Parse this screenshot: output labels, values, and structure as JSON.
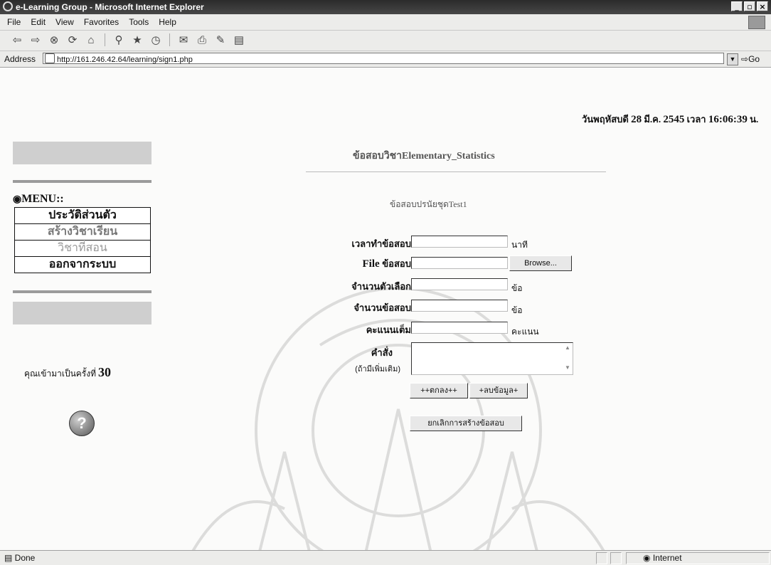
{
  "window": {
    "title": "e-Learning Group - Microsoft Internet Explorer",
    "buttons": {
      "minimize": "_",
      "maximize": "▫",
      "close": "×"
    }
  },
  "menubar": {
    "items": [
      "File",
      "Edit",
      "View",
      "Favorites",
      "Tools",
      "Help"
    ]
  },
  "toolbar": {
    "icons": [
      "back-icon",
      "forward-icon",
      "stop-icon",
      "refresh-icon",
      "home-icon",
      "search-icon",
      "favorites-icon",
      "history-icon",
      "mail-icon",
      "print-icon",
      "edit-icon",
      "discuss-icon"
    ]
  },
  "addressbar": {
    "label": "Address",
    "url": "http://161.246.42.64/learning/sign1.php",
    "go_label": "Go"
  },
  "page": {
    "datetime_prefix": "วันพฤหัสบดี",
    "datetime_day": "28",
    "datetime_month": "มี.ค.",
    "datetime_year": "2545",
    "datetime_time_label": "เวลา",
    "datetime_time": "16:06:39",
    "datetime_suffix": "น.",
    "course_title": "ข้อสอบวิชาElementary_Statistics",
    "subtitle": "ข้อสอบปรนัยชุดTest1",
    "sidebar": {
      "menu_title": "MENU::",
      "items": [
        "ประวัติส่วนตัว",
        "สร้างวิชาเรียน",
        "วิชาที่สอน",
        "ออกจากระบบ"
      ],
      "visit_text": "คุณเข้ามาเป็นครั้งที่",
      "visit_count": "30"
    },
    "form": {
      "time_label": "เวลาทำข้อสอบ",
      "time_unit": "นาที",
      "file_label_en": "File",
      "file_label_th": "ข้อสอบ",
      "browse_label": "Browse...",
      "choices_label": "จำนวนตัวเลือก",
      "choices_unit": "ข้อ",
      "count_label": "จำนวนข้อสอบ",
      "count_unit": "ข้อ",
      "score_label": "คะแนนเต็ม",
      "score_unit": "คะแนน",
      "instruction_label": "คำสั่ง",
      "instruction_hint": "(ถ้ามีเพิ่มเติม)",
      "ok_label": "++ตกลง++",
      "clear_label": "+ลบข้อมูล+",
      "cancel_label": "ยกเลิกการสร้างข้อสอบ"
    }
  },
  "statusbar": {
    "status": "Done",
    "zone": "Internet"
  }
}
